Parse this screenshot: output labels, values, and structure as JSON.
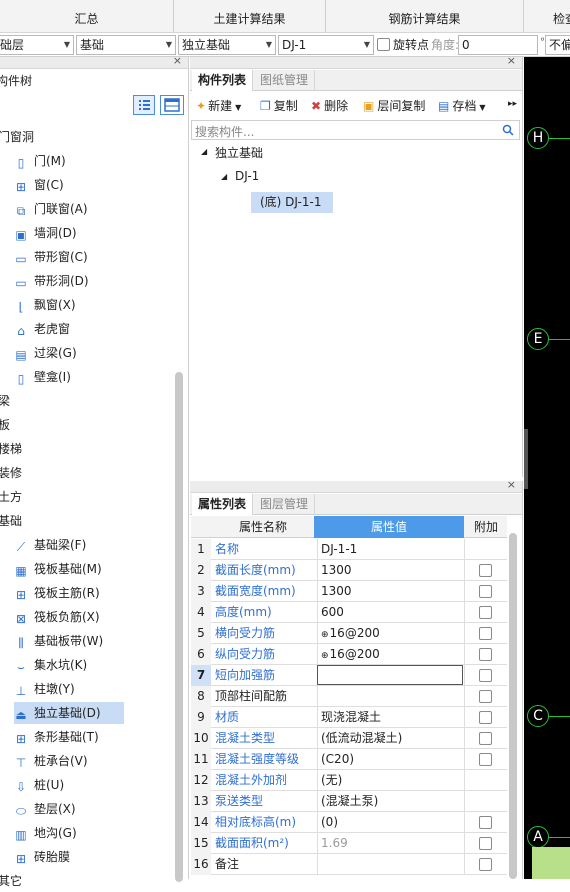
{
  "top_tabs": [
    "汇总",
    "土建计算结果",
    "钢筋计算结果",
    "检查"
  ],
  "filters": {
    "floor": "础层",
    "category": "基础",
    "type": "独立基础",
    "component": "DJ-1",
    "rotate_label": "旋转点",
    "angle_label": "角度:",
    "angle_value": "0",
    "offset_value": "不偏"
  },
  "left_panel": {
    "title": "构件树",
    "groups": [
      {
        "label": "门窗洞",
        "children": [
          "门(M)",
          "窗(C)",
          "门联窗(A)",
          "墙洞(D)",
          "带形窗(C)",
          "带形洞(D)",
          "飘窗(X)",
          "老虎窗",
          "过梁(G)",
          "壁龛(I)"
        ]
      },
      {
        "label": "梁",
        "children": []
      },
      {
        "label": "板",
        "children": []
      },
      {
        "label": "楼梯",
        "children": []
      },
      {
        "label": "装修",
        "children": []
      },
      {
        "label": "土方",
        "children": []
      },
      {
        "label": "基础",
        "children": [
          "基础梁(F)",
          "筏板基础(M)",
          "筏板主筋(R)",
          "筏板负筋(X)",
          "基础板带(W)",
          "集水坑(K)",
          "柱墩(Y)",
          "独立基础(D)",
          "条形基础(T)",
          "桩承台(V)",
          "桩(U)",
          "垫层(X)",
          "地沟(G)",
          "砖胎膜"
        ]
      },
      {
        "label": "其它",
        "children": []
      }
    ],
    "selected": "独立基础(D)"
  },
  "component_panel": {
    "tabs": [
      "构件列表",
      "图纸管理"
    ],
    "toolbar": [
      "新建",
      "复制",
      "删除",
      "层间复制",
      "存档"
    ],
    "search_placeholder": "搜索构件...",
    "tree": {
      "root": "独立基础",
      "child": "DJ-1",
      "leaf": "(底) DJ-1-1"
    }
  },
  "property_panel": {
    "tabs": [
      "属性列表",
      "图层管理"
    ],
    "headers": [
      "属性名称",
      "属性值",
      "附加"
    ],
    "rows": [
      {
        "n": "1",
        "name": "名称",
        "value": "DJ-1-1",
        "blue": true,
        "cb": false
      },
      {
        "n": "2",
        "name": "截面长度(mm)",
        "value": "1300",
        "blue": true,
        "cb": true
      },
      {
        "n": "3",
        "name": "截面宽度(mm)",
        "value": "1300",
        "blue": true,
        "cb": true
      },
      {
        "n": "4",
        "name": "高度(mm)",
        "value": "600",
        "blue": true,
        "cb": true
      },
      {
        "n": "5",
        "name": "横向受力筋",
        "value": " 16@200",
        "blue": true,
        "cb": true
      },
      {
        "n": "6",
        "name": "纵向受力筋",
        "value": " 16@200",
        "blue": true,
        "cb": true
      },
      {
        "n": "7",
        "name": "短向加强筋",
        "value": "",
        "blue": true,
        "cb": true
      },
      {
        "n": "8",
        "name": "顶部柱间配筋",
        "value": "",
        "blue": false,
        "cb": true
      },
      {
        "n": "9",
        "name": "材质",
        "value": "现浇混凝土",
        "blue": true,
        "cb": true
      },
      {
        "n": "10",
        "name": "混凝土类型",
        "value": "(低流动混凝土)",
        "blue": true,
        "cb": true
      },
      {
        "n": "11",
        "name": "混凝土强度等级",
        "value": "(C20)",
        "blue": true,
        "cb": true
      },
      {
        "n": "12",
        "name": "混凝土外加剂",
        "value": "(无)",
        "blue": true,
        "cb": false
      },
      {
        "n": "13",
        "name": "泵送类型",
        "value": "(混凝土泵)",
        "blue": true,
        "cb": false
      },
      {
        "n": "14",
        "name": "相对底标高(m)",
        "value": "(0)",
        "blue": true,
        "cb": true
      },
      {
        "n": "15",
        "name": "截面面积(m²)",
        "value": "1.69",
        "blue": true,
        "cb": true
      },
      {
        "n": "16",
        "name": "备注",
        "value": "",
        "blue": false,
        "cb": true
      }
    ]
  },
  "canvas": {
    "axes": [
      "H",
      "E",
      "C",
      "A"
    ]
  },
  "colors": {
    "accent": "#2f6fd0",
    "header_blue": "#4d9be8",
    "axis_green": "#27c03a"
  }
}
